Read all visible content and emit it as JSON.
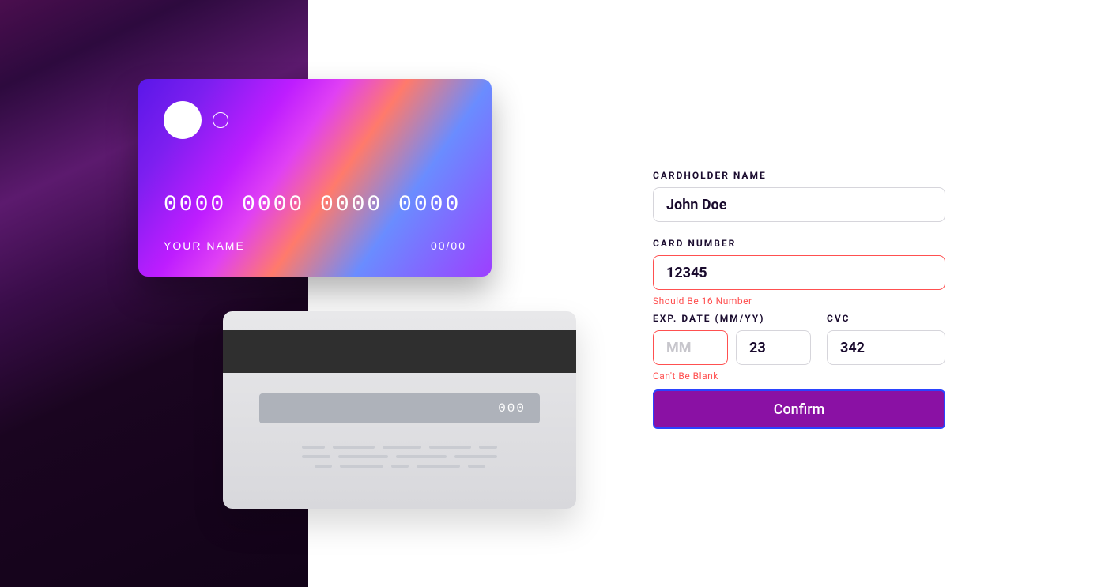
{
  "card_front": {
    "number": "0000 0000 0000 0000",
    "name": "YOUR NAME",
    "expiry": "00/00"
  },
  "card_back": {
    "cvc": "000"
  },
  "form": {
    "cardholder": {
      "label": "CARDHOLDER NAME",
      "value": "John Doe"
    },
    "card_number": {
      "label": "CARD NUMBER",
      "value": "12345",
      "error": "Should Be 16 Number"
    },
    "exp": {
      "label": "EXP. DATE (MM/YY)",
      "mm_placeholder": "MM",
      "mm_value": "",
      "yy_value": "23",
      "error": "Can't Be Blank"
    },
    "cvc": {
      "label": "CVC",
      "value": "342"
    },
    "confirm_label": "Confirm"
  }
}
